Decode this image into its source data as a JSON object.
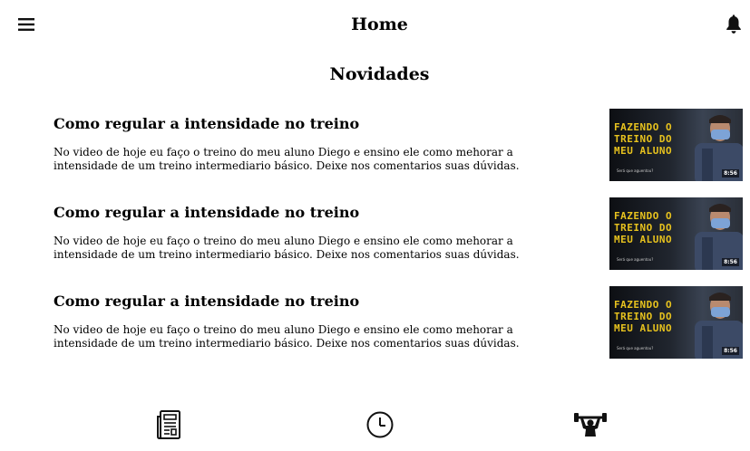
{
  "header": {
    "title": "Home",
    "menu_icon": "menu-icon",
    "notification_icon": "bell-icon"
  },
  "section": {
    "title": "Novidades"
  },
  "posts": [
    {
      "title": "Como regular a intensidade no treino",
      "description": "No video de hoje eu faço o treino do meu aluno Diego e ensino ele como mehorar a intensidade de um treino intermediario básico. Deixe nos comentarios suas dúvidas.",
      "thumbnail": {
        "caption": "Fazendo o treino do meu aluno",
        "subtitle": "Será que aguentou?",
        "duration": "8:56"
      }
    },
    {
      "title": "Como regular a intensidade no treino",
      "description": "No video de hoje eu faço o treino do meu aluno Diego e ensino ele como mehorar a intensidade de um treino intermediario básico. Deixe nos comentarios suas dúvidas.",
      "thumbnail": {
        "caption": "Fazendo o treino do meu aluno",
        "subtitle": "Será que aguentou?",
        "duration": "8:56"
      }
    },
    {
      "title": "Como regular a intensidade no treino",
      "description": "No video de hoje eu faço o treino do meu aluno Diego e ensino ele como mehorar a intensidade de um treino intermediario básico. Deixe nos comentarios suas dúvidas.",
      "thumbnail": {
        "caption": "Fazendo o treino do meu aluno",
        "subtitle": "Será que aguentou?",
        "duration": "8:56"
      }
    }
  ],
  "bottom_nav": {
    "items": [
      {
        "icon": "newspaper-icon"
      },
      {
        "icon": "clock-icon"
      },
      {
        "icon": "weightlifter-icon"
      }
    ]
  },
  "colors": {
    "background": "#ffffff",
    "text": "#000000",
    "thumbnail_caption": "#e7c21e"
  }
}
